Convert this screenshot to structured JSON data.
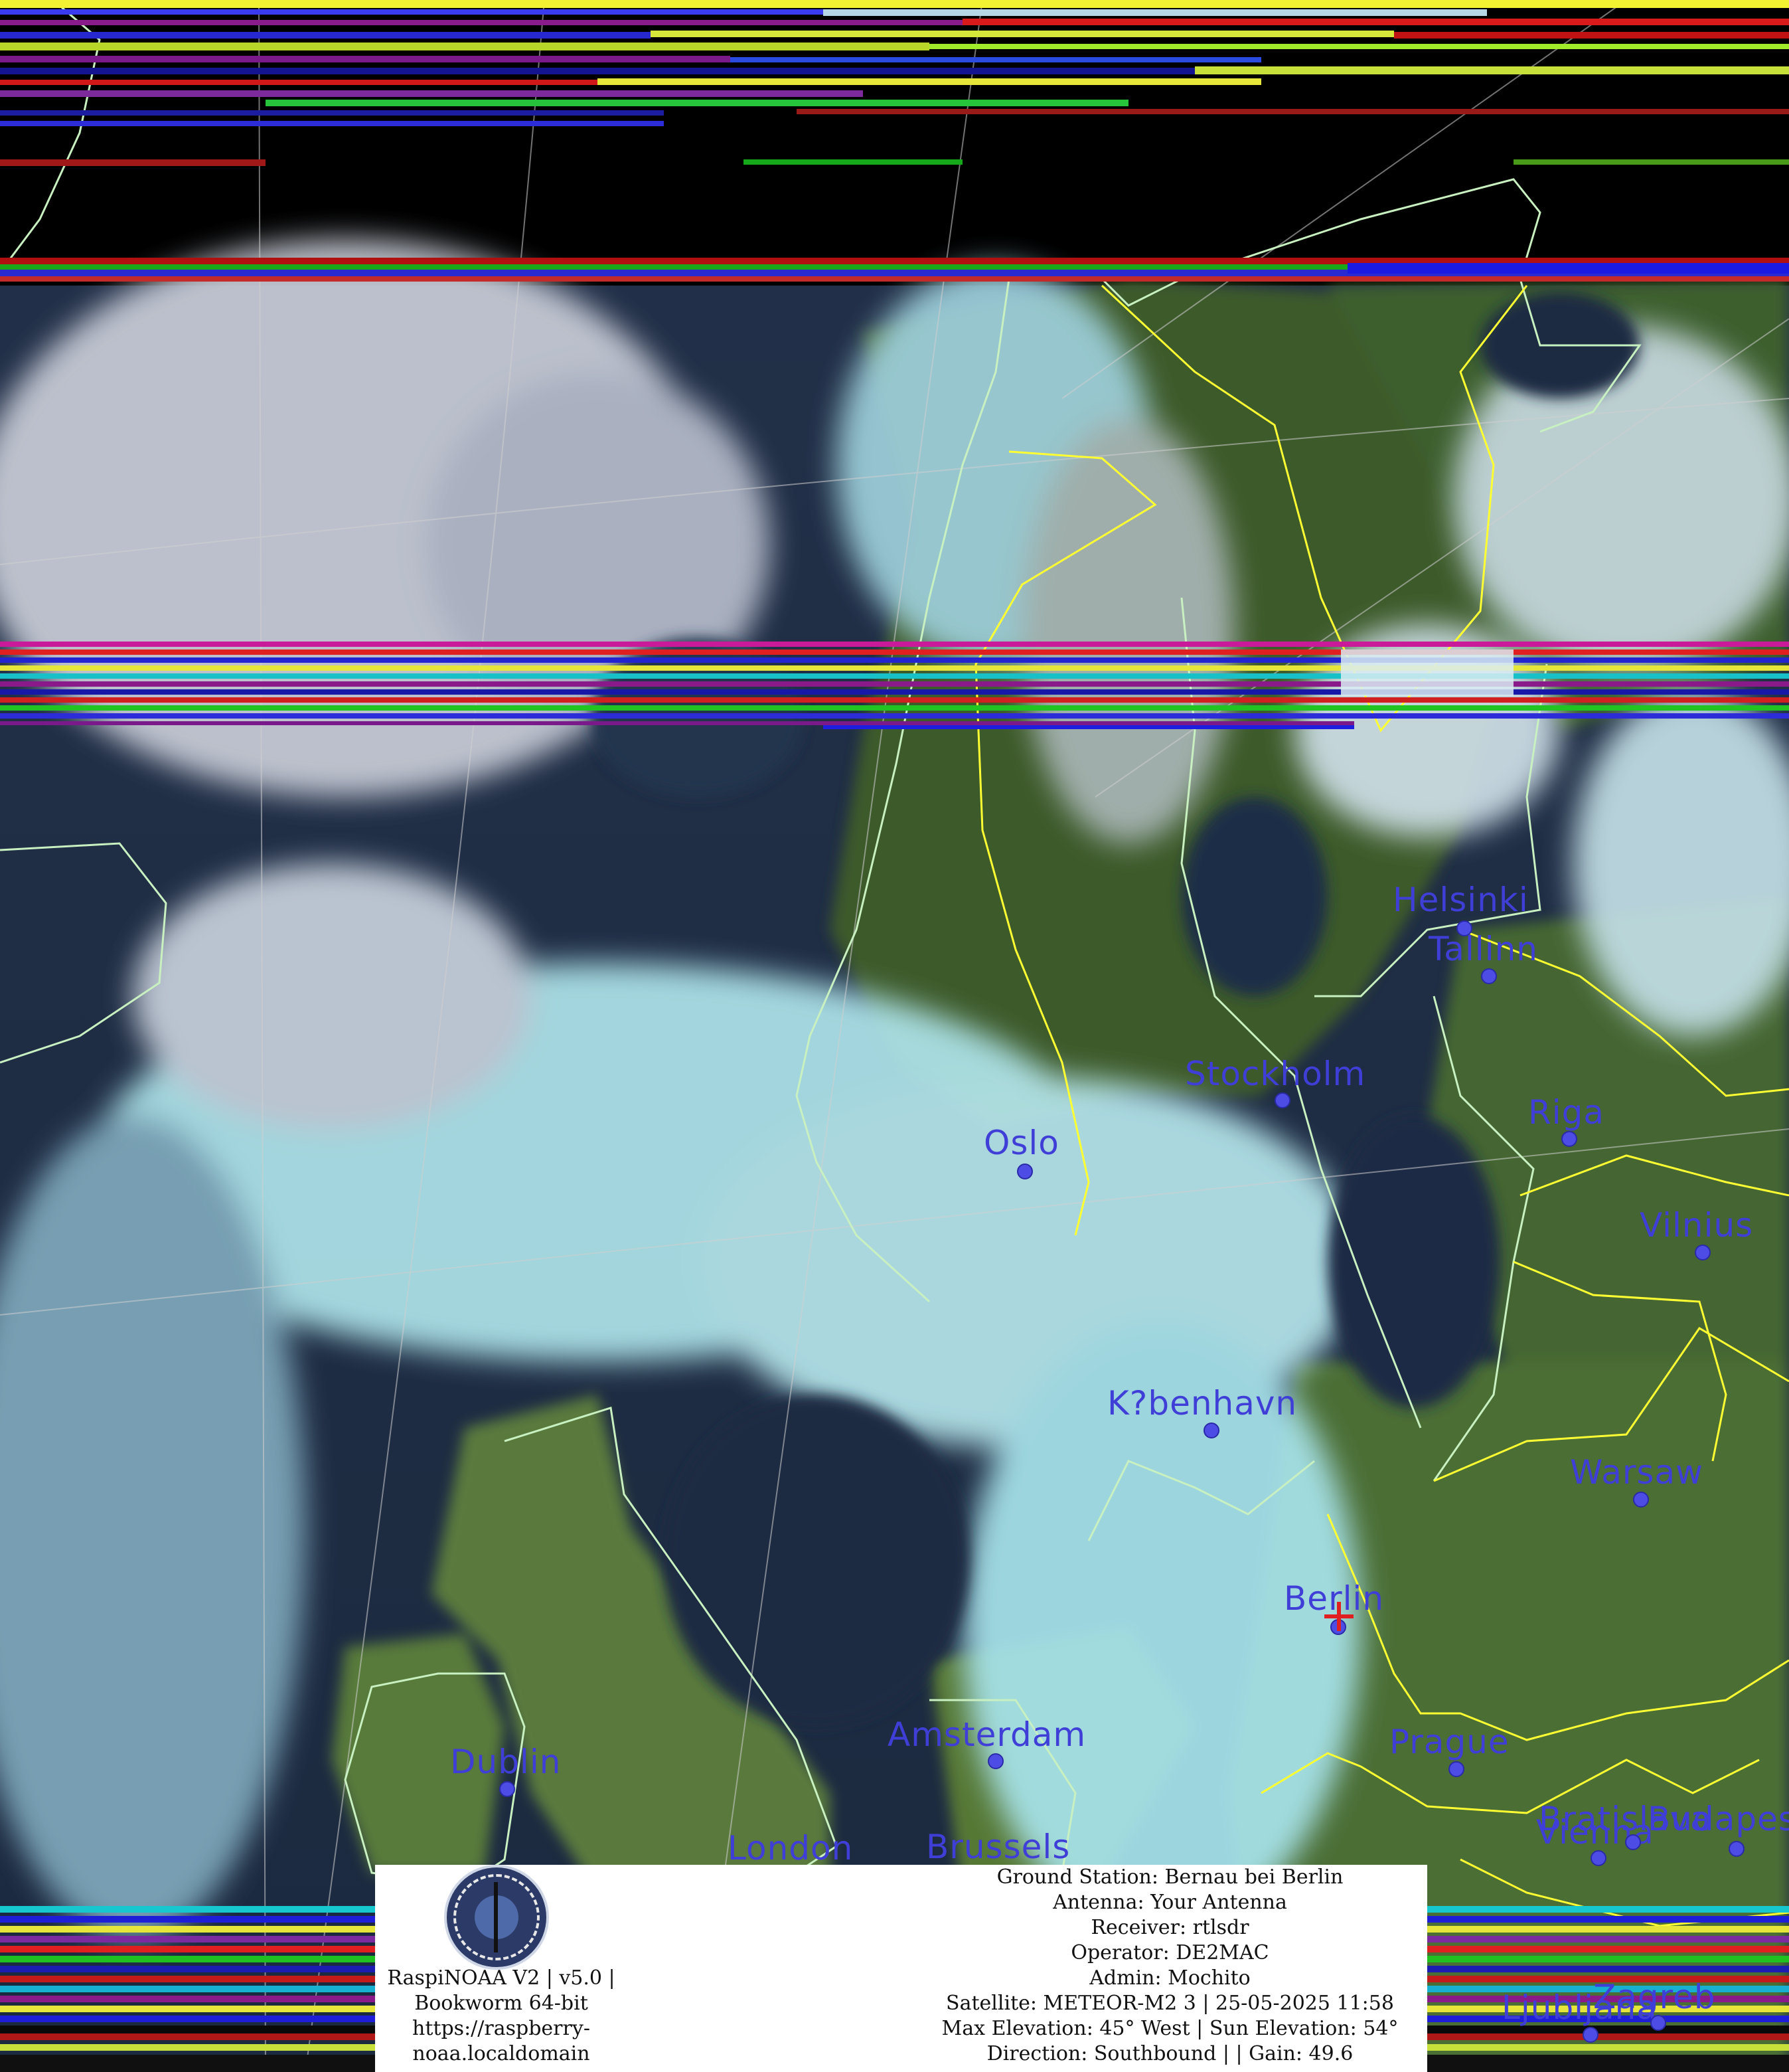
{
  "colors": {
    "city_label": "#3f3fd8",
    "city_dot": "#4d4de6",
    "coastline": "#c8f0c0",
    "border": "#ffff33",
    "station_marker": "#e02020"
  },
  "cities": [
    {
      "name": "Helsinki"
    },
    {
      "name": "Tallinn"
    },
    {
      "name": "Stockholm"
    },
    {
      "name": "Riga"
    },
    {
      "name": "Oslo"
    },
    {
      "name": "Vilnius"
    },
    {
      "name": "K?benhavn"
    },
    {
      "name": "Warsaw"
    },
    {
      "name": "Berlin"
    },
    {
      "name": "Dublin"
    },
    {
      "name": "Amsterdam"
    },
    {
      "name": "Prague"
    },
    {
      "name": "London"
    },
    {
      "name": "Brussels"
    },
    {
      "name": "Bratislava"
    },
    {
      "name": "Budapest"
    },
    {
      "name": "Vienna"
    },
    {
      "name": "Ljubljana"
    },
    {
      "name": "Zagreb"
    }
  ],
  "panel": {
    "left_lines": [
      "RaspiNOAA V2 | v5.0 |",
      "Bookworm 64-bit",
      "https://raspberry-",
      "noaa.localdomain"
    ],
    "right_lines": [
      "Ground Station: Bernau bei Berlin",
      "Antenna: Your Antenna",
      "Receiver: rtlsdr",
      "Operator: DE2MAC",
      "Admin: Mochito",
      "Satellite: METEOR-M2 3 | 25-05-2025 11:58",
      "Max Elevation: 45° West | Sun Elevation: 54°",
      "Direction: Southbound | | Gain: 49.6"
    ]
  }
}
